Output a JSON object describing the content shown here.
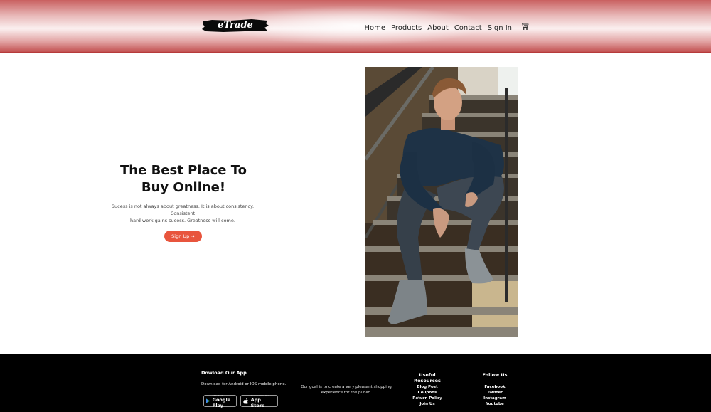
{
  "header": {
    "logo_text": "eTrade",
    "nav": [
      "Home",
      "Products",
      "About",
      "Contact",
      "Sign In"
    ],
    "cart_icon": "cart-icon"
  },
  "hero": {
    "title_line1": "The Best Place To",
    "title_line2": "Buy Online!",
    "subtitle_line1": "Sucess is not always about greatness. It is about consistency. Consistent",
    "subtitle_line2": "hard work gains sucess. Greatness will come.",
    "signup_label": "Sign Up ➔"
  },
  "footer": {
    "app": {
      "heading": "Dowload Our App",
      "text": "Download for Android or IOS mobile phone.",
      "google": {
        "small": "GET IT ON",
        "big": "Google Play"
      },
      "apple": {
        "small": "Download on the",
        "big": "App Store"
      }
    },
    "about_line1": "Our goal is to create a very pleasant shopping",
    "about_line2": "experience for the public.",
    "resources": {
      "heading": "Useful Resources",
      "items": [
        "Blog Post",
        "Coupons",
        "Return Policy",
        "Join Us"
      ]
    },
    "follow": {
      "heading": "Follow Us",
      "items": [
        "Facebook",
        "Twitter",
        "Instagram",
        "Youtube"
      ]
    }
  },
  "colors": {
    "accent": "#e8553d",
    "header_red": "#c25151",
    "footer_bg": "#000000"
  }
}
